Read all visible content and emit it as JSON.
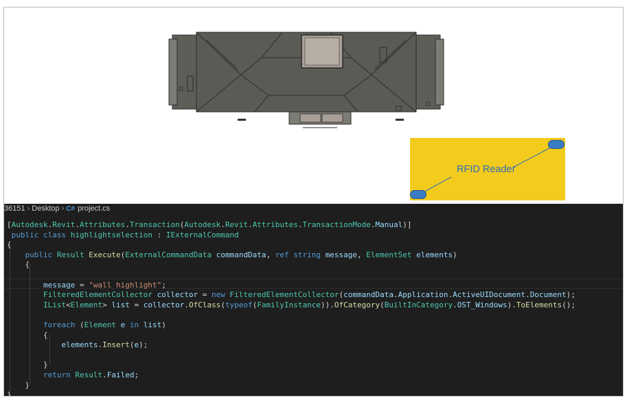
{
  "breadcrumb": {
    "prefix": "36151",
    "folder": "Desktop",
    "file_icon": "csharp-icon",
    "file_icon_glyph": "C#",
    "file": "project.cs"
  },
  "rfid": {
    "label": "RFID Reader",
    "panel_color": "#f2cb1d",
    "node_color": "#3a7cc4"
  },
  "code": {
    "lines": [
      [
        [
          "pl",
          "["
        ],
        [
          "ty",
          "Autodesk"
        ],
        [
          "pl",
          "."
        ],
        [
          "ty",
          "Revit"
        ],
        [
          "pl",
          "."
        ],
        [
          "ty",
          "Attributes"
        ],
        [
          "pl",
          "."
        ],
        [
          "ty",
          "Transaction"
        ],
        [
          "pl",
          "("
        ],
        [
          "ty",
          "Autodesk"
        ],
        [
          "pl",
          "."
        ],
        [
          "ty",
          "Revit"
        ],
        [
          "pl",
          "."
        ],
        [
          "ty",
          "Attributes"
        ],
        [
          "pl",
          "."
        ],
        [
          "ty",
          "TransactionMode"
        ],
        [
          "pl",
          "."
        ],
        [
          "va",
          "Manual"
        ],
        [
          "pl",
          ")]"
        ]
      ],
      [
        [
          "pl",
          " "
        ],
        [
          "kw",
          "public"
        ],
        [
          "pl",
          " "
        ],
        [
          "kw",
          "class"
        ],
        [
          "pl",
          " "
        ],
        [
          "ty",
          "highlightselection"
        ],
        [
          "pl",
          " : "
        ],
        [
          "ty",
          "IExternalCommand"
        ]
      ],
      [
        [
          "pl",
          "{"
        ]
      ],
      [
        [
          "pl",
          "    "
        ],
        [
          "kw",
          "public"
        ],
        [
          "pl",
          " "
        ],
        [
          "ty",
          "Result"
        ],
        [
          "pl",
          " "
        ],
        [
          "fn",
          "Execute"
        ],
        [
          "pl",
          "("
        ],
        [
          "ty",
          "ExternalCommandData"
        ],
        [
          "pl",
          " "
        ],
        [
          "va",
          "commandData"
        ],
        [
          "pl",
          ", "
        ],
        [
          "kw",
          "ref"
        ],
        [
          "pl",
          " "
        ],
        [
          "kw",
          "string"
        ],
        [
          "pl",
          " "
        ],
        [
          "va",
          "message"
        ],
        [
          "pl",
          ", "
        ],
        [
          "ty",
          "ElementSet"
        ],
        [
          "pl",
          " "
        ],
        [
          "va",
          "elements"
        ],
        [
          "pl",
          ")"
        ]
      ],
      [
        [
          "pl",
          "    {"
        ]
      ],
      [
        [
          "pl",
          ""
        ]
      ],
      [
        [
          "pl",
          "        "
        ],
        [
          "va",
          "message"
        ],
        [
          "pl",
          " = "
        ],
        [
          "st",
          "\"wall highlight\""
        ],
        [
          "pl",
          ";"
        ]
      ],
      [
        [
          "pl",
          "        "
        ],
        [
          "ty",
          "FilteredElementCollector"
        ],
        [
          "pl",
          " "
        ],
        [
          "va",
          "collector"
        ],
        [
          "pl",
          " = "
        ],
        [
          "kw",
          "new"
        ],
        [
          "pl",
          " "
        ],
        [
          "ty",
          "FilteredElementCollector"
        ],
        [
          "pl",
          "("
        ],
        [
          "va",
          "commandData"
        ],
        [
          "pl",
          "."
        ],
        [
          "va",
          "Application"
        ],
        [
          "pl",
          "."
        ],
        [
          "va",
          "ActiveUIDocument"
        ],
        [
          "pl",
          "."
        ],
        [
          "va",
          "Document"
        ],
        [
          "pl",
          ");"
        ]
      ],
      [
        [
          "pl",
          "        "
        ],
        [
          "ty",
          "IList"
        ],
        [
          "pl",
          "<"
        ],
        [
          "ty",
          "Element"
        ],
        [
          "pl",
          "> "
        ],
        [
          "va",
          "list"
        ],
        [
          "pl",
          " = "
        ],
        [
          "va",
          "collector"
        ],
        [
          "pl",
          "."
        ],
        [
          "fn",
          "OfClass"
        ],
        [
          "pl",
          "("
        ],
        [
          "kw",
          "typeof"
        ],
        [
          "pl",
          "("
        ],
        [
          "ty",
          "FamilyInstance"
        ],
        [
          "pl",
          "))."
        ],
        [
          "fn",
          "OfCategory"
        ],
        [
          "pl",
          "("
        ],
        [
          "ty",
          "BuiltInCategory"
        ],
        [
          "pl",
          "."
        ],
        [
          "va",
          "OST_Windows"
        ],
        [
          "pl",
          ")."
        ],
        [
          "fn",
          "ToElements"
        ],
        [
          "pl",
          "();"
        ]
      ],
      [
        [
          "pl",
          ""
        ]
      ],
      [
        [
          "pl",
          "        "
        ],
        [
          "kw",
          "foreach"
        ],
        [
          "pl",
          " ("
        ],
        [
          "ty",
          "Element"
        ],
        [
          "pl",
          " "
        ],
        [
          "va",
          "e"
        ],
        [
          "pl",
          " "
        ],
        [
          "kw",
          "in"
        ],
        [
          "pl",
          " "
        ],
        [
          "va",
          "list"
        ],
        [
          "pl",
          ")"
        ]
      ],
      [
        [
          "pl",
          "        {"
        ]
      ],
      [
        [
          "pl",
          "            "
        ],
        [
          "va",
          "elements"
        ],
        [
          "pl",
          "."
        ],
        [
          "fn",
          "Insert"
        ],
        [
          "pl",
          "("
        ],
        [
          "va",
          "e"
        ],
        [
          "pl",
          ");"
        ]
      ],
      [
        [
          "pl",
          ""
        ]
      ],
      [
        [
          "pl",
          "        }"
        ]
      ],
      [
        [
          "pl",
          "        "
        ],
        [
          "kw",
          "return"
        ],
        [
          "pl",
          " "
        ],
        [
          "ty",
          "Result"
        ],
        [
          "pl",
          "."
        ],
        [
          "va",
          "Failed"
        ],
        [
          "pl",
          ";"
        ]
      ],
      [
        [
          "pl",
          "    }"
        ]
      ],
      [
        [
          "pl",
          "}"
        ]
      ]
    ]
  }
}
